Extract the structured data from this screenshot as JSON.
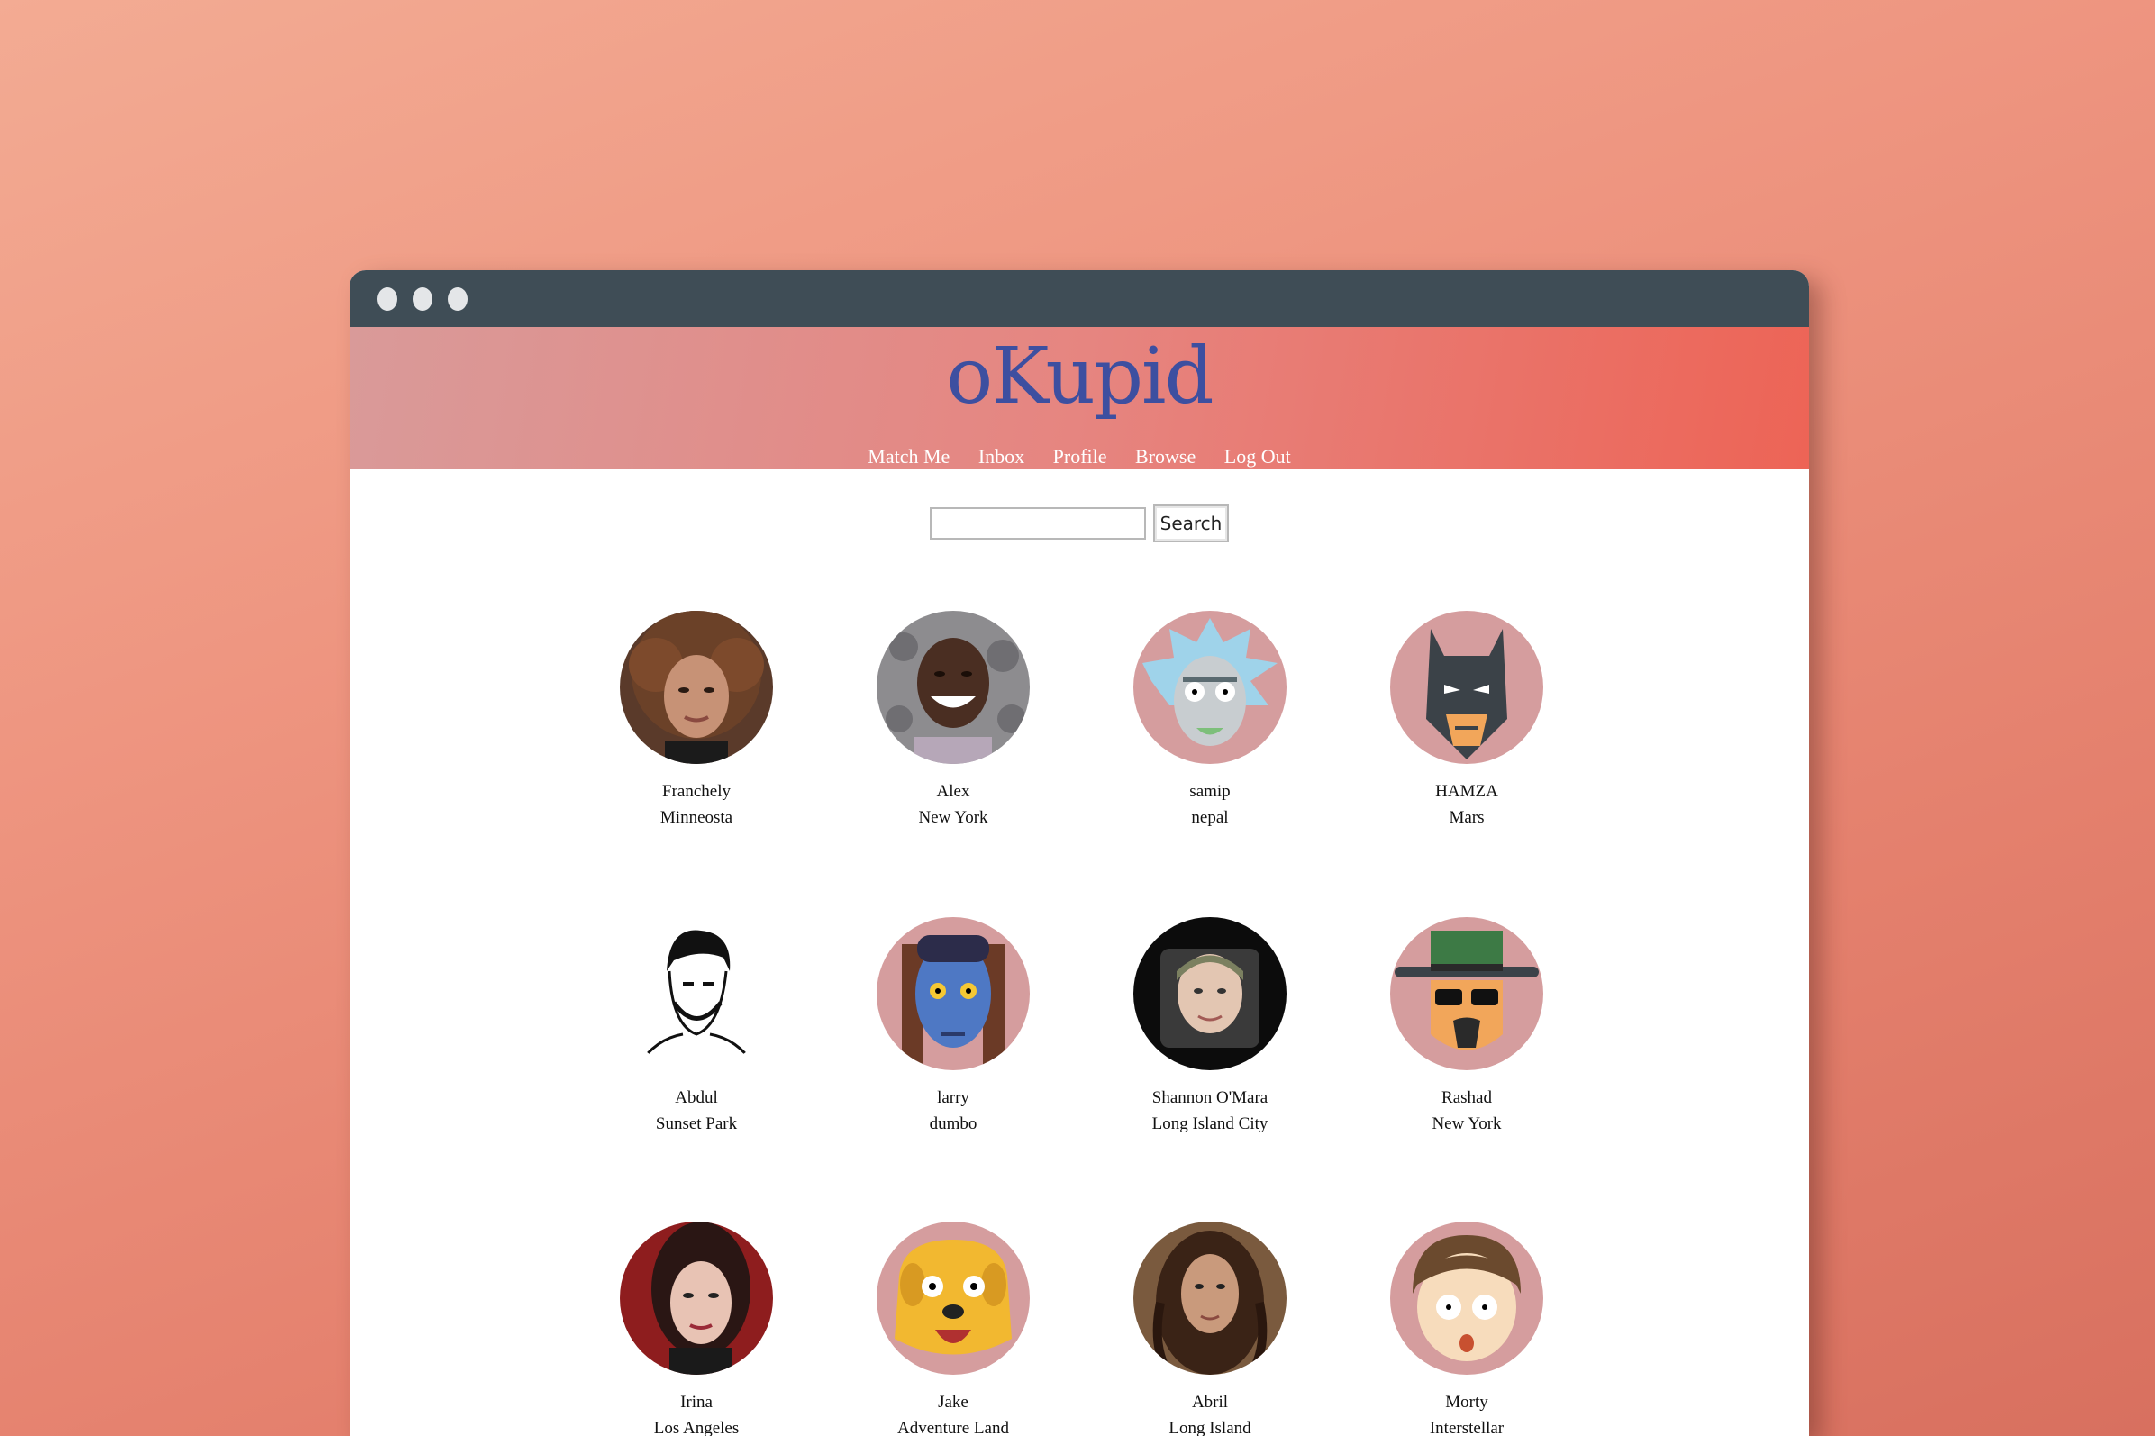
{
  "site": {
    "logo": "oKupid"
  },
  "nav": [
    "Match Me",
    "Inbox",
    "Profile",
    "Browse",
    "Log Out"
  ],
  "search": {
    "value": "",
    "button": "Search"
  },
  "profiles": [
    {
      "name": "Franchely",
      "location": "Minneosta",
      "avatar": "photo-woman-curly-hair"
    },
    {
      "name": "Alex",
      "location": "New York",
      "avatar": "photo-man-smiling"
    },
    {
      "name": "samip",
      "location": "nepal",
      "avatar": "rick-cartoon"
    },
    {
      "name": "HAMZA",
      "location": "Mars",
      "avatar": "batman-cartoon"
    },
    {
      "name": "Abdul",
      "location": "Sunset Park",
      "avatar": "sketch-man"
    },
    {
      "name": "larry",
      "location": "dumbo",
      "avatar": "avatar-navi-cartoon"
    },
    {
      "name": "Shannon O'Mara",
      "location": "Long Island City",
      "avatar": "photo-blonde-woman"
    },
    {
      "name": "Rashad",
      "location": "New York",
      "avatar": "heisenberg-cartoon"
    },
    {
      "name": "Irina",
      "location": "Los Angeles",
      "avatar": "photo-woman-dark-hair"
    },
    {
      "name": "Jake",
      "location": "Adventure Land",
      "avatar": "jake-dog-cartoon"
    },
    {
      "name": "Abril",
      "location": "Long Island",
      "avatar": "photo-woman-wavy-hair"
    },
    {
      "name": "Morty",
      "location": "Interstellar",
      "avatar": "morty-cartoon"
    }
  ],
  "colors": {
    "logo": "#3d4fa0",
    "titlebar": "#3f4d56",
    "avatar_bg": "#d59d9e"
  }
}
